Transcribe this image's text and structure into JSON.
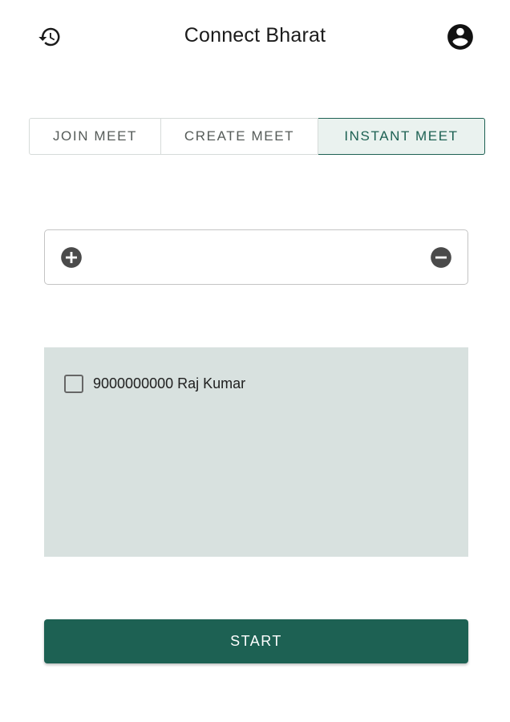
{
  "header": {
    "title": "Connect Bharat",
    "left_icon": "history-icon",
    "right_icon": "account-circle-icon"
  },
  "tabs": [
    {
      "label": "JOIN MEET",
      "selected": false
    },
    {
      "label": "CREATE MEET",
      "selected": false
    },
    {
      "label": "INSTANT MEET",
      "selected": true
    }
  ],
  "number_field": {
    "value": "",
    "placeholder": "",
    "add_icon": "add-circle-icon",
    "remove_icon": "remove-circle-icon"
  },
  "contacts": [
    {
      "label": "9000000000 Raj Kumar",
      "checked": false
    }
  ],
  "start_button": {
    "label": "START"
  },
  "colors": {
    "primary": "#1d6153",
    "tab_selected_bg": "#eaf2ef",
    "panel_bg": "#d8e1df",
    "icon_dark": "#1a1a1a",
    "icon_grey": "#4a4a4a"
  }
}
